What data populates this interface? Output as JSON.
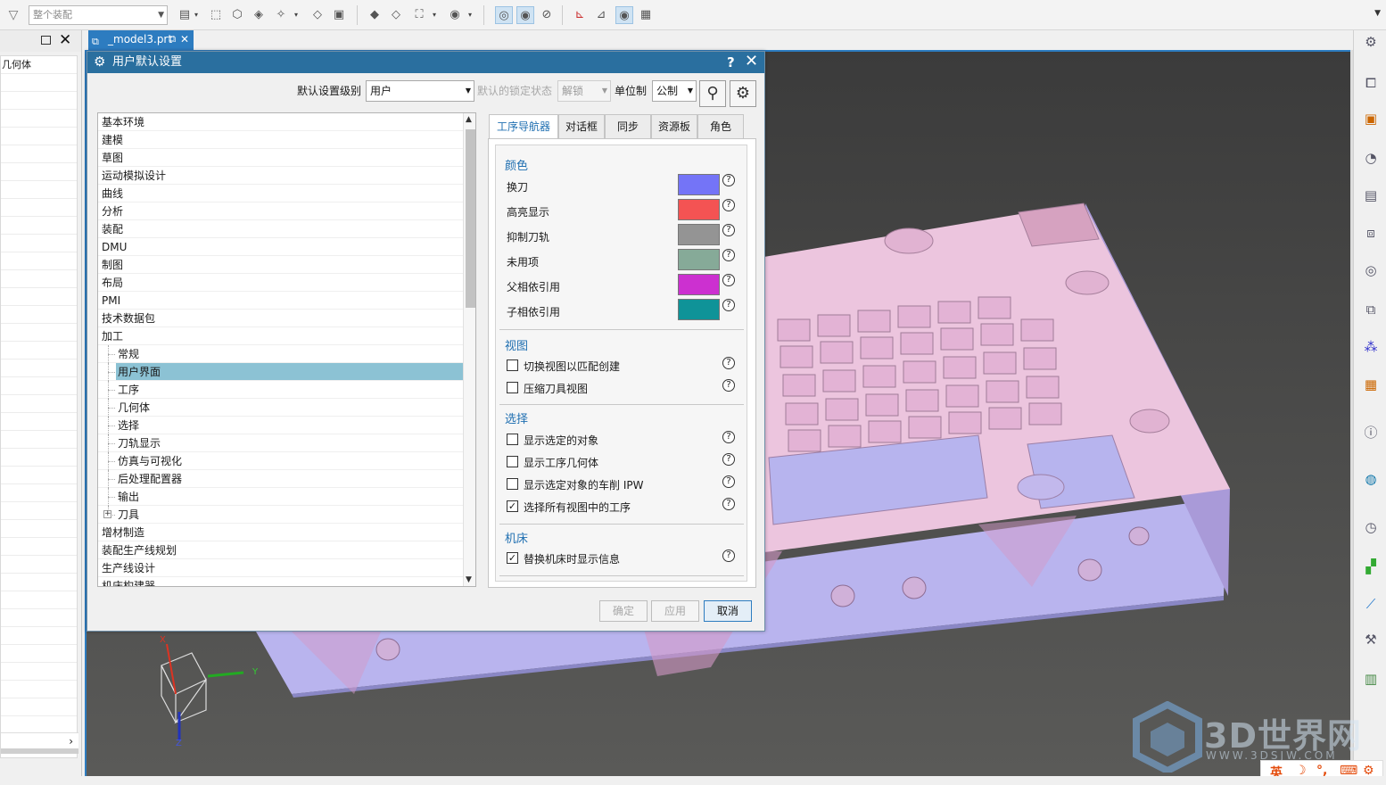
{
  "toolbar": {
    "selection_filter": "整个装配"
  },
  "file_tab": {
    "name": "_model3.prt"
  },
  "left_nav": {
    "visible_label": "几何体"
  },
  "dialog": {
    "title": "用户默认设置",
    "help": "?",
    "level_label": "默认设置级别",
    "level_value": "用户",
    "lock_label": "默认的锁定状态",
    "lock_value": "解锁",
    "units_label": "单位制",
    "units_value": "公制",
    "tree": [
      {
        "label": "基本环境",
        "level": 0
      },
      {
        "label": "建模",
        "level": 0
      },
      {
        "label": "草图",
        "level": 0
      },
      {
        "label": "运动模拟设计",
        "level": 0
      },
      {
        "label": "曲线",
        "level": 0
      },
      {
        "label": "分析",
        "level": 0
      },
      {
        "label": "装配",
        "level": 0
      },
      {
        "label": "DMU",
        "level": 0
      },
      {
        "label": "制图",
        "level": 0
      },
      {
        "label": "布局",
        "level": 0
      },
      {
        "label": "PMI",
        "level": 0
      },
      {
        "label": "技术数据包",
        "level": 0
      },
      {
        "label": "加工",
        "level": 0
      },
      {
        "label": "常规",
        "level": 1
      },
      {
        "label": "用户界面",
        "level": 1,
        "selected": true
      },
      {
        "label": "工序",
        "level": 1
      },
      {
        "label": "几何体",
        "level": 1
      },
      {
        "label": "选择",
        "level": 1
      },
      {
        "label": "刀轨显示",
        "level": 1
      },
      {
        "label": "仿真与可视化",
        "level": 1
      },
      {
        "label": "后处理配置器",
        "level": 1
      },
      {
        "label": "输出",
        "level": 1
      },
      {
        "label": "刀具",
        "level": 1,
        "expandable": true
      },
      {
        "label": "增材制造",
        "level": 0
      },
      {
        "label": "装配生产线规划",
        "level": 0
      },
      {
        "label": "生产线设计",
        "level": 0
      },
      {
        "label": "机床构建器",
        "level": 0
      }
    ],
    "tabs": [
      "工序导航器",
      "对话框",
      "同步",
      "资源板",
      "角色"
    ],
    "active_tab": "工序导航器",
    "sections": {
      "color": {
        "title": "颜色",
        "rows": [
          {
            "label": "换刀",
            "color": "#7474f7"
          },
          {
            "label": "高亮显示",
            "color": "#f45353"
          },
          {
            "label": "抑制刀轨",
            "color": "#949494"
          },
          {
            "label": "未用项",
            "color": "#86aa98"
          },
          {
            "label": "父相依引用",
            "color": "#cc30d0"
          },
          {
            "label": "子相依引用",
            "color": "#0f9398"
          }
        ]
      },
      "view": {
        "title": "视图",
        "options": [
          {
            "label": "切换视图以匹配创建",
            "checked": false
          },
          {
            "label": "压缩刀具视图",
            "checked": false
          }
        ]
      },
      "select": {
        "title": "选择",
        "options": [
          {
            "label": "显示选定的对象",
            "checked": false
          },
          {
            "label": "显示工序几何体",
            "checked": false
          },
          {
            "label": "显示选定对象的车削 IPW",
            "checked": false
          },
          {
            "label": "选择所有视图中的工序",
            "checked": true
          }
        ]
      },
      "machine": {
        "title": "机床",
        "options": [
          {
            "label": "替换机床时显示信息",
            "checked": true
          }
        ]
      }
    },
    "buttons": {
      "ok": "确定",
      "apply": "应用",
      "cancel": "取消"
    }
  },
  "viewport": {
    "triad": {
      "x": "X",
      "y": "Y",
      "z": "Z"
    }
  },
  "watermark": {
    "text": "3D世界网",
    "url": "WWW.3DSJW.COM"
  },
  "ime": {
    "lang": "英"
  }
}
